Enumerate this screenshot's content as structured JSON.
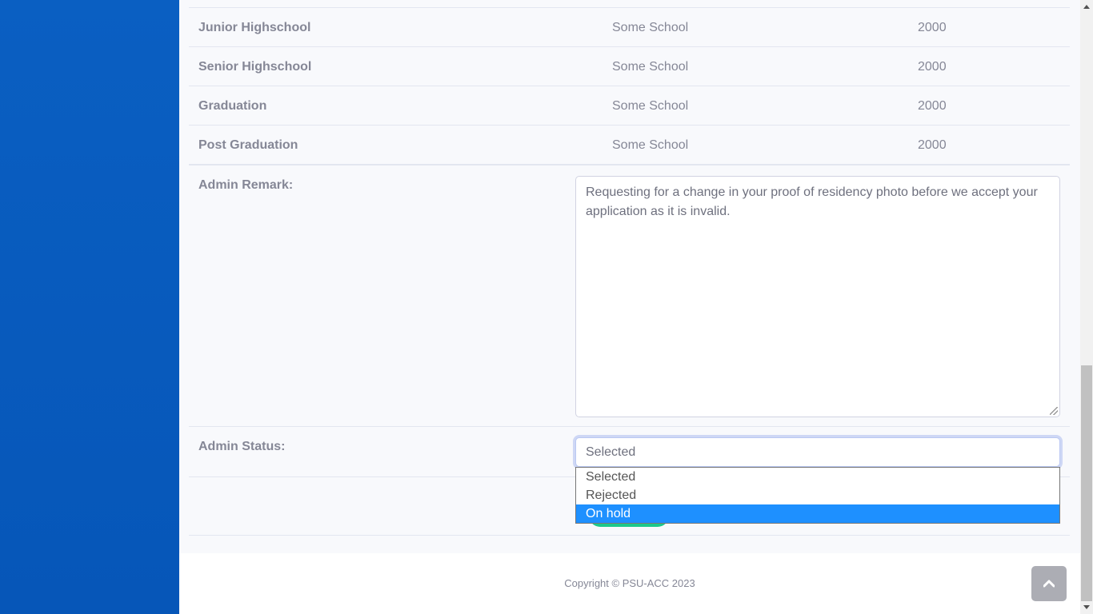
{
  "education_rows": [
    {
      "level": "Junior Highschool",
      "school": "Some School",
      "year": "2000"
    },
    {
      "level": "Senior Highschool",
      "school": "Some School",
      "year": "2000"
    },
    {
      "level": "Graduation",
      "school": "Some School",
      "year": "2000"
    },
    {
      "level": "Post Graduation",
      "school": "Some School",
      "year": "2000"
    }
  ],
  "admin_remark": {
    "label": "Admin Remark:",
    "value": "Requesting for a change in your proof of residency photo before we accept your application as it is invalid."
  },
  "admin_status": {
    "label": "Admin Status:",
    "selected": "Selected",
    "options": [
      "Selected",
      "Rejected",
      "On hold"
    ],
    "highlighted": "On hold"
  },
  "footer": {
    "copyright": "Copyright © PSU-ACC 2023"
  },
  "icons": {
    "scroll_top": "chevron-up-icon"
  },
  "colors": {
    "sidebar": "#0a5fc2",
    "highlight": "#1e90ff",
    "submit": "#1cc88a"
  }
}
